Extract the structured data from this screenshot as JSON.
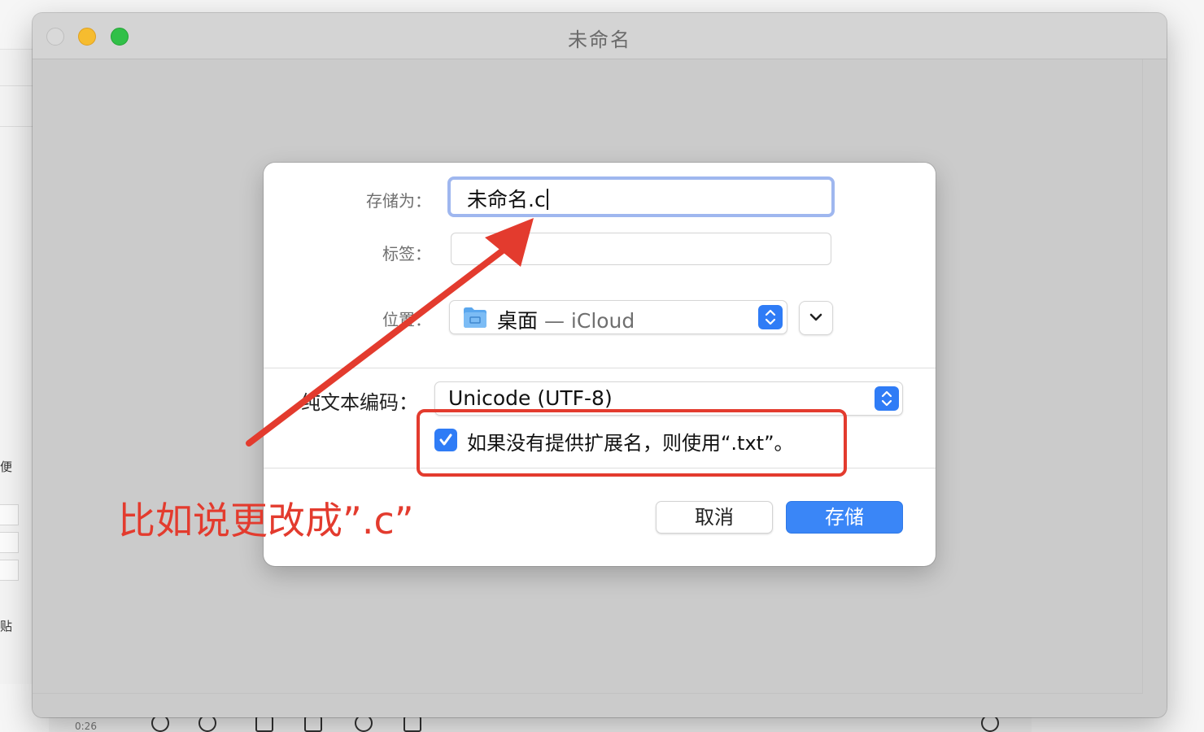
{
  "window": {
    "title": "未命名"
  },
  "save_dialog": {
    "save_as_label": "存储为：",
    "save_as_value": "未命名.c",
    "tags_label": "标签：",
    "tags_value": "",
    "location_label": "位置：",
    "location_name": "桌面",
    "location_detail": "— iCloud",
    "encoding_label": "纯文本编码：",
    "encoding_value": "Unicode (UTF-8)",
    "extension_checkbox_label": "如果没有提供扩展名，则使用“.txt”。",
    "extension_checkbox_checked": true,
    "cancel_label": "取消",
    "save_label": "存储"
  },
  "annotation": {
    "note": "比如说更改成”.c”",
    "color": "#e33b2e"
  },
  "background": {
    "left_text_1": "便",
    "left_text_2": "贴",
    "bottom_time": "0:26"
  },
  "colors": {
    "accent": "#2f7cf6",
    "focus_ring": "#9fb7ef",
    "window_bg": "#cbcbcb"
  }
}
